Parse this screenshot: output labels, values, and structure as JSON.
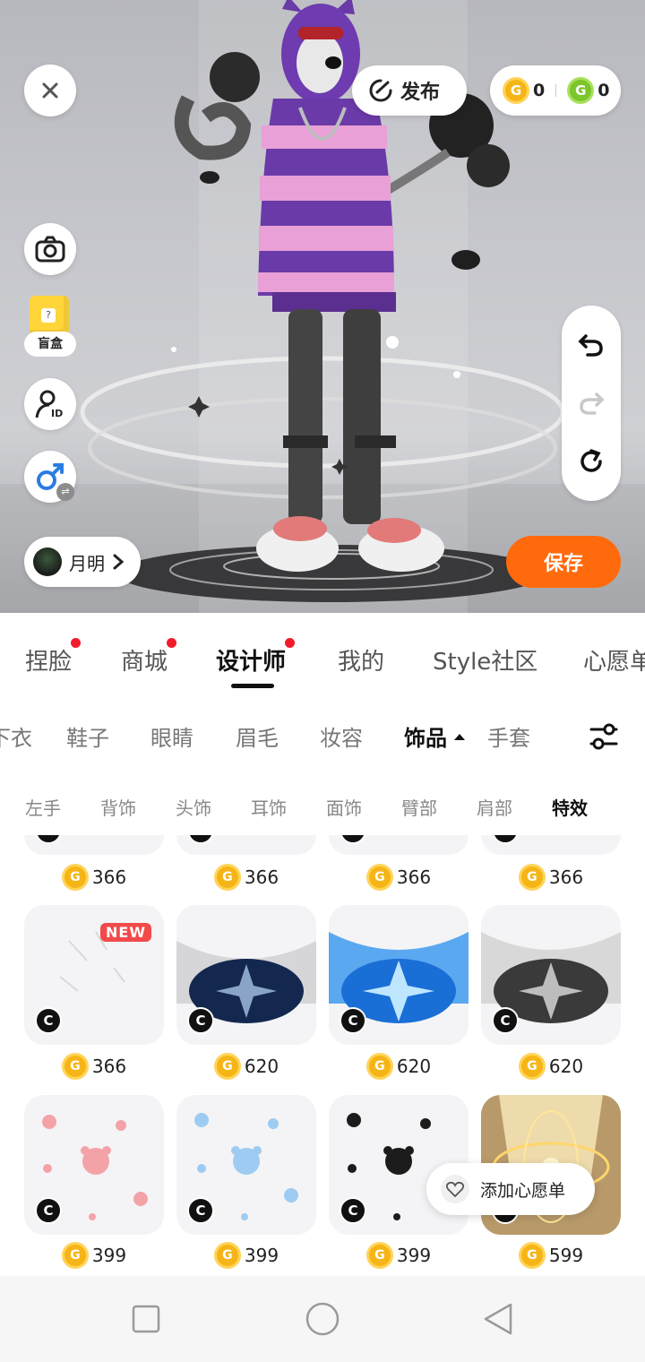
{
  "stage": {
    "publish_label": "发布",
    "gold_balance": "0",
    "green_balance": "0",
    "blindbox_label": "盲盒",
    "user_name": "月明",
    "save_label": "保存"
  },
  "main_tabs": [
    {
      "label": "捏脸",
      "dot": true
    },
    {
      "label": "商城",
      "dot": true
    },
    {
      "label": "设计师",
      "dot": true,
      "active": true
    },
    {
      "label": "我的",
      "dot": false
    },
    {
      "label": "Style社区",
      "dot": false
    },
    {
      "label": "心愿单",
      "dot": false
    }
  ],
  "categories": [
    "下衣",
    "鞋子",
    "眼睛",
    "眉毛",
    "妆容",
    "饰品",
    "手套"
  ],
  "active_category": "饰品",
  "subcategories": [
    "左手",
    "背饰",
    "头饰",
    "耳饰",
    "面饰",
    "臂部",
    "肩部",
    "特效"
  ],
  "active_subcategory": "特效",
  "items": {
    "row0": [
      "366",
      "366",
      "366",
      "366"
    ],
    "row1": [
      "366",
      "620",
      "620",
      "620"
    ],
    "row2": [
      "399",
      "399",
      "399",
      "599"
    ],
    "new_badge": "NEW",
    "c_badge": "C"
  },
  "wish_label": "添加心愿单",
  "colors": {
    "accent": "#ff6a0c",
    "coin_gold": "#f6b516",
    "coin_green": "#7cc52a",
    "dot_red": "#f21b2c"
  }
}
